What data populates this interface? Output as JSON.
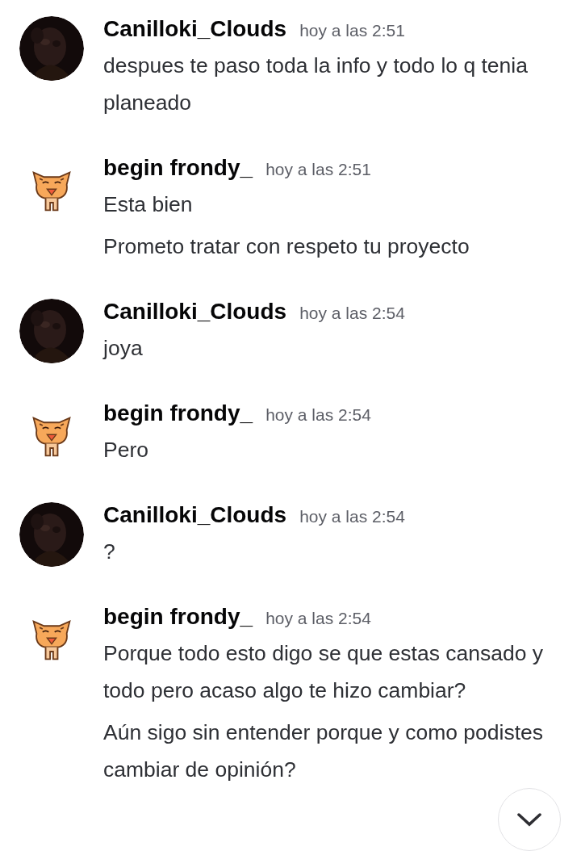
{
  "messages": [
    {
      "author": "Canilloki_Clouds",
      "time": "hoy a las 2:51",
      "avatar": {
        "kind": "picture"
      },
      "paragraphs": [
        "despues te paso toda la info y todo lo q tenia planeado"
      ]
    },
    {
      "author": "begin frondy_",
      "time": "hoy a las 2:51",
      "avatar": {
        "kind": "cat"
      },
      "paragraphs": [
        "Esta bien",
        "Prometo tratar con respeto tu proyecto"
      ]
    },
    {
      "author": "Canilloki_Clouds",
      "time": "hoy a las 2:54",
      "avatar": {
        "kind": "picture"
      },
      "paragraphs": [
        "joya"
      ]
    },
    {
      "author": "begin frondy_",
      "time": "hoy a las 2:54",
      "avatar": {
        "kind": "cat"
      },
      "paragraphs": [
        "Pero"
      ]
    },
    {
      "author": "Canilloki_Clouds",
      "time": "hoy a las 2:54",
      "avatar": {
        "kind": "picture"
      },
      "paragraphs": [
        "?"
      ]
    },
    {
      "author": "begin frondy_",
      "time": "hoy a las 2:54",
      "avatar": {
        "kind": "cat"
      },
      "paragraphs": [
        "Porque todo esto digo se que estas cansado y todo pero acaso algo te hizo cambiar?",
        "Aún sigo sin entender porque y como podistes cambiar de opinión?"
      ]
    }
  ],
  "scroll_button": {
    "kind": "jump-down"
  }
}
